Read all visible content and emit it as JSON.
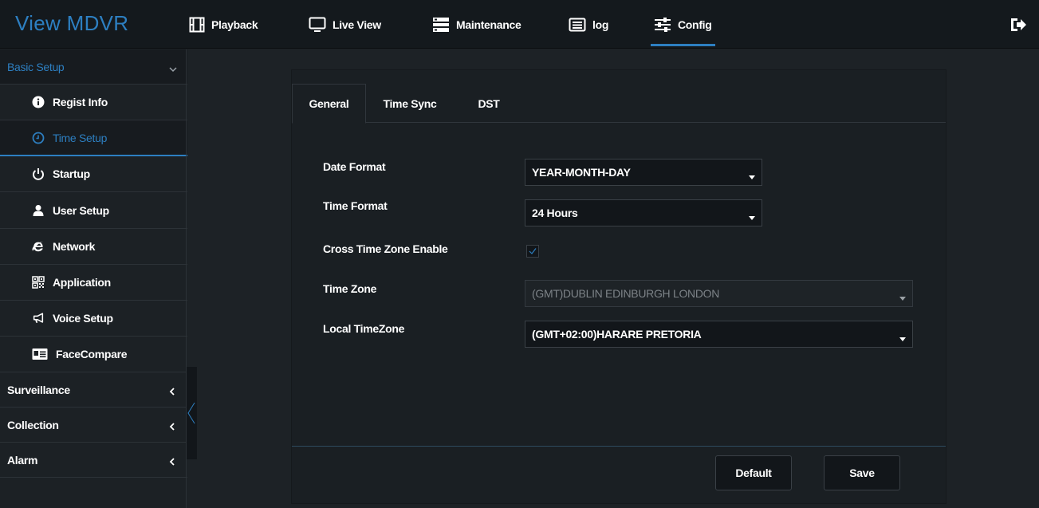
{
  "app": {
    "title": "View MDVR"
  },
  "nav": [
    {
      "label": "Playback",
      "icon": "film-icon"
    },
    {
      "label": "Live View",
      "icon": "monitor-icon"
    },
    {
      "label": "Maintenance",
      "icon": "server-icon"
    },
    {
      "label": "log",
      "icon": "list-icon"
    },
    {
      "label": "Config",
      "icon": "sliders-icon",
      "active": true
    }
  ],
  "sidebar": {
    "sections": [
      {
        "label": "Basic Setup",
        "expanded": true
      },
      {
        "label": "Surveillance"
      },
      {
        "label": "Collection"
      },
      {
        "label": "Alarm"
      }
    ],
    "items": [
      {
        "label": "Regist Info",
        "icon": "info-icon"
      },
      {
        "label": "Time Setup",
        "icon": "clock-icon",
        "active": true
      },
      {
        "label": "Startup",
        "icon": "power-icon"
      },
      {
        "label": "User Setup",
        "icon": "user-icon"
      },
      {
        "label": "Network",
        "icon": "ie-icon"
      },
      {
        "label": "Application",
        "icon": "qr-icon"
      },
      {
        "label": "Voice Setup",
        "icon": "megaphone-icon"
      },
      {
        "label": "FaceCompare",
        "icon": "id-card-icon"
      }
    ]
  },
  "tabs": [
    {
      "label": "General",
      "active": true
    },
    {
      "label": "Time Sync"
    },
    {
      "label": "DST"
    }
  ],
  "form": {
    "date_format": {
      "label": "Date Format",
      "value": "YEAR-MONTH-DAY"
    },
    "time_format": {
      "label": "Time Format",
      "value": "24 Hours"
    },
    "cross_tz": {
      "label": "Cross Time Zone Enable",
      "checked": true
    },
    "time_zone": {
      "label": "Time Zone",
      "value": "(GMT)DUBLIN EDINBURGH LONDON",
      "disabled": true
    },
    "local_tz": {
      "label": "Local TimeZone",
      "value": "(GMT+02:00)HARARE PRETORIA"
    }
  },
  "buttons": {
    "default": "Default",
    "save": "Save"
  },
  "colors": {
    "accent": "#2d7fc1",
    "background": "#1d2226",
    "panel": "#1a1f23"
  }
}
